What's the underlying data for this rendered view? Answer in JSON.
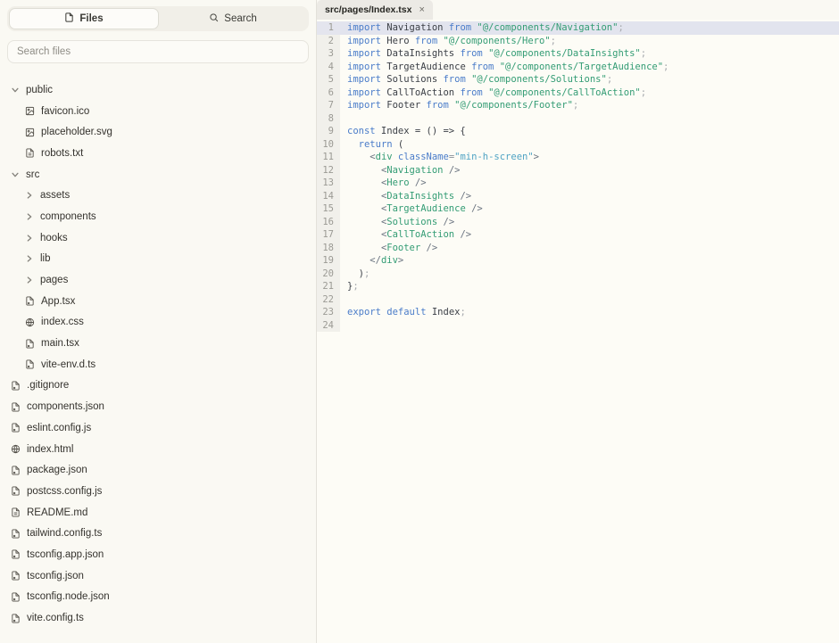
{
  "sidebar": {
    "tabs": [
      {
        "label": "Files",
        "icon": "file-icon",
        "active": true
      },
      {
        "label": "Search",
        "icon": "search-icon",
        "active": false
      }
    ],
    "search": {
      "placeholder": "Search files"
    },
    "tree": [
      {
        "label": "public",
        "icon": "chevron-down-icon",
        "level": 0
      },
      {
        "label": "favicon.ico",
        "icon": "image-icon",
        "level": 1
      },
      {
        "label": "placeholder.svg",
        "icon": "image-icon",
        "level": 1
      },
      {
        "label": "robots.txt",
        "icon": "doc-icon",
        "level": 1
      },
      {
        "label": "src",
        "icon": "chevron-down-icon",
        "level": 0
      },
      {
        "label": "assets",
        "icon": "chevron-right-icon",
        "level": 1
      },
      {
        "label": "components",
        "icon": "chevron-right-icon",
        "level": 1
      },
      {
        "label": "hooks",
        "icon": "chevron-right-icon",
        "level": 1
      },
      {
        "label": "lib",
        "icon": "chevron-right-icon",
        "level": 1
      },
      {
        "label": "pages",
        "icon": "chevron-right-icon",
        "level": 1
      },
      {
        "label": "App.tsx",
        "icon": "code-file-icon",
        "level": 1
      },
      {
        "label": "index.css",
        "icon": "globe-icon",
        "level": 1
      },
      {
        "label": "main.tsx",
        "icon": "code-file-icon",
        "level": 1
      },
      {
        "label": "vite-env.d.ts",
        "icon": "code-file-icon",
        "level": 1
      },
      {
        "label": ".gitignore",
        "icon": "code-file-icon",
        "level": 0
      },
      {
        "label": "components.json",
        "icon": "code-file-icon",
        "level": 0
      },
      {
        "label": "eslint.config.js",
        "icon": "code-file-icon",
        "level": 0
      },
      {
        "label": "index.html",
        "icon": "globe-icon",
        "level": 0
      },
      {
        "label": "package.json",
        "icon": "code-file-icon",
        "level": 0
      },
      {
        "label": "postcss.config.js",
        "icon": "code-file-icon",
        "level": 0
      },
      {
        "label": "README.md",
        "icon": "doc-icon",
        "level": 0
      },
      {
        "label": "tailwind.config.ts",
        "icon": "code-file-icon",
        "level": 0
      },
      {
        "label": "tsconfig.app.json",
        "icon": "code-file-icon",
        "level": 0
      },
      {
        "label": "tsconfig.json",
        "icon": "code-file-icon",
        "level": 0
      },
      {
        "label": "tsconfig.node.json",
        "icon": "code-file-icon",
        "level": 0
      },
      {
        "label": "vite.config.ts",
        "icon": "code-file-icon",
        "level": 0
      }
    ]
  },
  "editor": {
    "tab": {
      "title": "src/pages/Index.tsx",
      "close_glyph": "×"
    },
    "active_line": 1,
    "colors": {
      "keyword": "#4a7cc9",
      "string": "#339c74",
      "attr_string": "#4fa3c4",
      "active_line_bg": "#e2e4ee"
    },
    "lines": [
      [
        [
          "k",
          "import"
        ],
        [
          "p",
          " Navigation "
        ],
        [
          "k",
          "from"
        ],
        [
          "s",
          " \"@/components/Navigation\""
        ],
        [
          "x",
          ";"
        ]
      ],
      [
        [
          "k",
          "import"
        ],
        [
          "p",
          " Hero "
        ],
        [
          "k",
          "from"
        ],
        [
          "s",
          " \"@/components/Hero\""
        ],
        [
          "x",
          ";"
        ]
      ],
      [
        [
          "k",
          "import"
        ],
        [
          "p",
          " DataInsights "
        ],
        [
          "k",
          "from"
        ],
        [
          "s",
          " \"@/components/DataInsights\""
        ],
        [
          "x",
          ";"
        ]
      ],
      [
        [
          "k",
          "import"
        ],
        [
          "p",
          " TargetAudience "
        ],
        [
          "k",
          "from"
        ],
        [
          "s",
          " \"@/components/TargetAudience\""
        ],
        [
          "x",
          ";"
        ]
      ],
      [
        [
          "k",
          "import"
        ],
        [
          "p",
          " Solutions "
        ],
        [
          "k",
          "from"
        ],
        [
          "s",
          " \"@/components/Solutions\""
        ],
        [
          "x",
          ";"
        ]
      ],
      [
        [
          "k",
          "import"
        ],
        [
          "p",
          " CallToAction "
        ],
        [
          "k",
          "from"
        ],
        [
          "s",
          " \"@/components/CallToAction\""
        ],
        [
          "x",
          ";"
        ]
      ],
      [
        [
          "k",
          "import"
        ],
        [
          "p",
          " Footer "
        ],
        [
          "k",
          "from"
        ],
        [
          "s",
          " \"@/components/Footer\""
        ],
        [
          "x",
          ";"
        ]
      ],
      [],
      [
        [
          "k",
          "const"
        ],
        [
          "p",
          " Index = () => {"
        ]
      ],
      [
        [
          "p",
          "  "
        ],
        [
          "k",
          "return"
        ],
        [
          "p",
          " ("
        ]
      ],
      [
        [
          "p",
          "    "
        ],
        [
          "b",
          "<"
        ],
        [
          "t",
          "div"
        ],
        [
          "p",
          " "
        ],
        [
          "a",
          "className"
        ],
        [
          "e",
          "="
        ],
        [
          "c",
          "\"min-h-screen\""
        ],
        [
          "b",
          ">"
        ]
      ],
      [
        [
          "p",
          "      "
        ],
        [
          "b",
          "<"
        ],
        [
          "t",
          "Navigation"
        ],
        [
          "p",
          " "
        ],
        [
          "b",
          "/>"
        ]
      ],
      [
        [
          "p",
          "      "
        ],
        [
          "b",
          "<"
        ],
        [
          "t",
          "Hero"
        ],
        [
          "p",
          " "
        ],
        [
          "b",
          "/>"
        ]
      ],
      [
        [
          "p",
          "      "
        ],
        [
          "b",
          "<"
        ],
        [
          "t",
          "DataInsights"
        ],
        [
          "p",
          " "
        ],
        [
          "b",
          "/>"
        ]
      ],
      [
        [
          "p",
          "      "
        ],
        [
          "b",
          "<"
        ],
        [
          "t",
          "TargetAudience"
        ],
        [
          "p",
          " "
        ],
        [
          "b",
          "/>"
        ]
      ],
      [
        [
          "p",
          "      "
        ],
        [
          "b",
          "<"
        ],
        [
          "t",
          "Solutions"
        ],
        [
          "p",
          " "
        ],
        [
          "b",
          "/>"
        ]
      ],
      [
        [
          "p",
          "      "
        ],
        [
          "b",
          "<"
        ],
        [
          "t",
          "CallToAction"
        ],
        [
          "p",
          " "
        ],
        [
          "b",
          "/>"
        ]
      ],
      [
        [
          "p",
          "      "
        ],
        [
          "b",
          "<"
        ],
        [
          "t",
          "Footer"
        ],
        [
          "p",
          " "
        ],
        [
          "b",
          "/>"
        ]
      ],
      [
        [
          "p",
          "    "
        ],
        [
          "b",
          "</"
        ],
        [
          "t",
          "div"
        ],
        [
          "b",
          ">"
        ]
      ],
      [
        [
          "p",
          "  )"
        ],
        [
          "x",
          ";"
        ]
      ],
      [
        [
          "p",
          "}"
        ],
        [
          "x",
          ";"
        ]
      ],
      [],
      [
        [
          "k",
          "export"
        ],
        [
          "p",
          " "
        ],
        [
          "k",
          "default"
        ],
        [
          "p",
          " Index"
        ],
        [
          "x",
          ";"
        ]
      ],
      []
    ]
  }
}
